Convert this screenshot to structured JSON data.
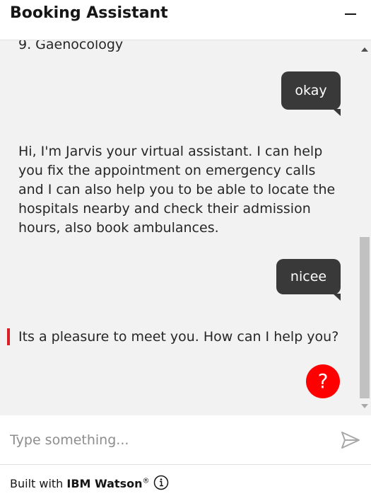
{
  "header": {
    "title": "Booking Assistant"
  },
  "messages": {
    "assistant_1": "9. Gaenocology",
    "user_1": "okay",
    "assistant_2": "Hi, I'm Jarvis your virtual assistant. I can help you fix the appointment on emergency calls and I can also help you to be able to locate the hospitals nearby and check their admission hours, also book ambulances.",
    "user_2": "nicee",
    "assistant_3": "Its a pleasure to meet you. How can I help you?"
  },
  "help_button": {
    "label": "?"
  },
  "input": {
    "placeholder": "Type something...",
    "value": ""
  },
  "footer": {
    "prefix": "Built with ",
    "brand": "IBM Watson",
    "trademark": "®"
  },
  "colors": {
    "bubble": "#393939",
    "chat_bg": "#f2f2f2",
    "help_red": "#ff0000",
    "accent_bar": "#da1e28"
  },
  "icons": {
    "minimize": "minimize-icon",
    "send": "send-icon",
    "info": "info-icon"
  }
}
